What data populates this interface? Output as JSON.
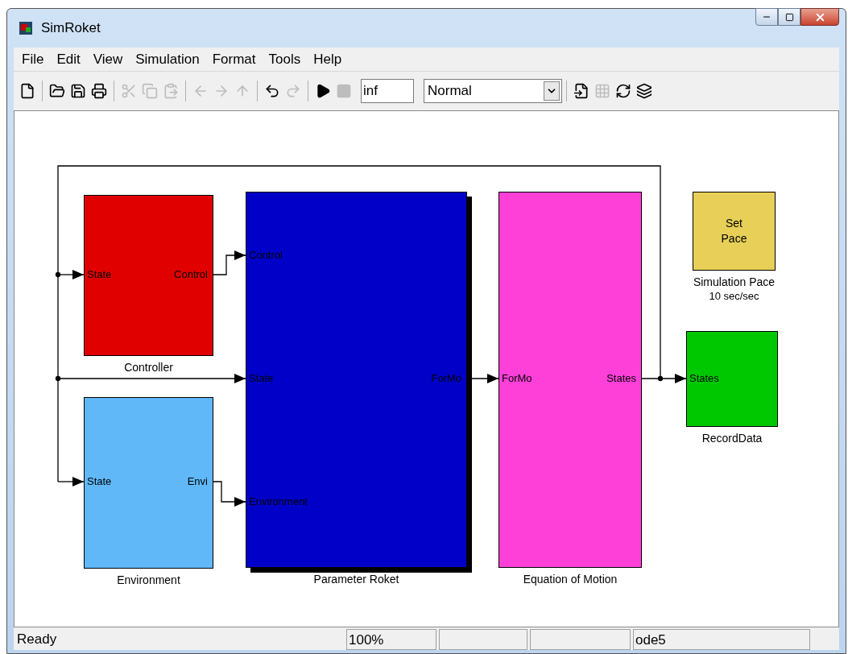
{
  "window": {
    "title": "SimRoket"
  },
  "menu": [
    "File",
    "Edit",
    "View",
    "Simulation",
    "Format",
    "Tools",
    "Help"
  ],
  "toolbar": {
    "buttons": [
      {
        "kind": "new",
        "disabled": false
      },
      {
        "kind": "sep"
      },
      {
        "kind": "open",
        "disabled": false
      },
      {
        "kind": "save",
        "disabled": false
      },
      {
        "kind": "print",
        "disabled": false
      },
      {
        "kind": "sep"
      },
      {
        "kind": "cut",
        "disabled": true
      },
      {
        "kind": "copy",
        "disabled": true
      },
      {
        "kind": "paste",
        "disabled": true
      },
      {
        "kind": "sep"
      },
      {
        "kind": "back",
        "disabled": true
      },
      {
        "kind": "forward",
        "disabled": true
      },
      {
        "kind": "up",
        "disabled": true
      },
      {
        "kind": "sep"
      },
      {
        "kind": "undo",
        "disabled": false
      },
      {
        "kind": "redo",
        "disabled": true
      },
      {
        "kind": "sep"
      },
      {
        "kind": "play",
        "disabled": false
      },
      {
        "kind": "stop",
        "disabled": true
      }
    ],
    "stop_time": "inf",
    "mode": "Normal",
    "extra_buttons": [
      {
        "kind": "scope",
        "disabled": false
      },
      {
        "kind": "library",
        "disabled": true
      },
      {
        "kind": "refresh",
        "disabled": false
      },
      {
        "kind": "layers",
        "disabled": false
      }
    ]
  },
  "blocks": [
    {
      "label": "Controller",
      "color": "#e00000",
      "shadow": false,
      "ports": [
        {
          "label": "State",
          "kind": "input"
        },
        {
          "label": "Control",
          "kind": "output"
        }
      ]
    },
    {
      "label": "Environment",
      "color": "#60b8f8",
      "shadow": false,
      "ports": [
        {
          "label": "State",
          "kind": "input"
        },
        {
          "label": "Envi",
          "kind": "output"
        }
      ]
    },
    {
      "label": "Parameter Roket",
      "color": "#0000c8",
      "shadow": true,
      "ports": [
        {
          "label": "Control",
          "kind": "input"
        },
        {
          "label": "State",
          "kind": "input"
        },
        {
          "label": "Environment",
          "kind": "input"
        },
        {
          "label": "ForMo",
          "kind": "output"
        }
      ]
    },
    {
      "label": "Equation of Motion",
      "color": "#ff40d8",
      "shadow": false,
      "ports": [
        {
          "label": "ForMo",
          "kind": "input"
        },
        {
          "label": "States",
          "kind": "output"
        }
      ]
    },
    {
      "label": "Simulation Pace",
      "sublabel": "10 sec/sec",
      "text": "Set Pace",
      "color": "#e8d058",
      "shadow": false
    },
    {
      "label": "RecordData",
      "color": "#00c800",
      "shadow": false,
      "ports": [
        {
          "label": "States",
          "kind": "input"
        }
      ]
    }
  ],
  "status_bar": {
    "message": "Ready",
    "zoom": "100%",
    "solver": "ode5"
  }
}
